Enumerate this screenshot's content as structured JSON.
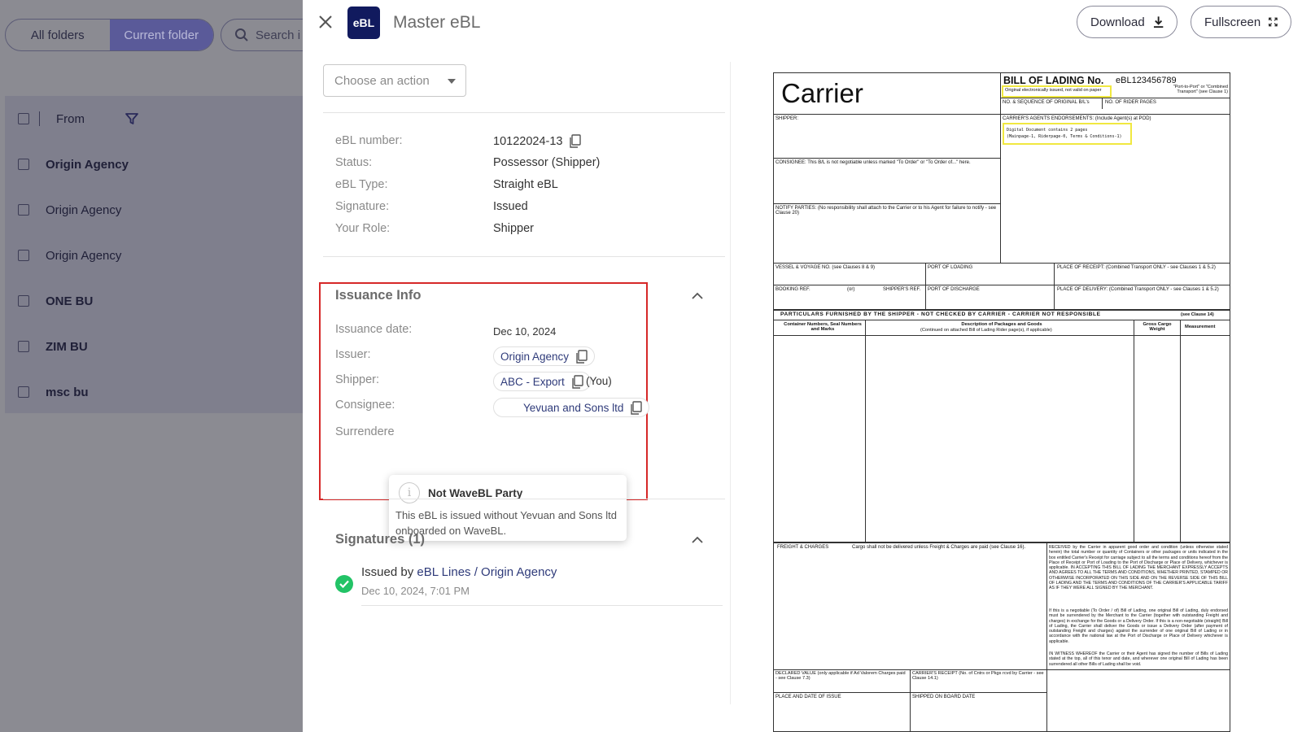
{
  "background": {
    "folders": [
      {
        "label": "All folders"
      },
      {
        "label": "Current folder"
      }
    ],
    "search_placeholder": "Search i",
    "table_header": "From",
    "rows": [
      {
        "label": "Origin Agency",
        "bold": true
      },
      {
        "label": "Origin Agency",
        "bold": false
      },
      {
        "label": "Origin Agency",
        "bold": false
      },
      {
        "label": "ONE BU",
        "bold": true
      },
      {
        "label": "ZIM BU",
        "bold": true
      },
      {
        "label": "msc bu",
        "bold": true
      }
    ]
  },
  "header": {
    "badge": "eBL",
    "title": "Master eBL",
    "download_label": "Download",
    "fullscreen_label": "Fullscreen"
  },
  "action_select": {
    "placeholder": "Choose an action"
  },
  "details": [
    {
      "key": "eBL number:",
      "value": "10122024-13"
    },
    {
      "key": "Status:",
      "value": "Possessor (Shipper)"
    },
    {
      "key": "eBL Type:",
      "value": "Straight eBL"
    },
    {
      "key": "Signature:",
      "value": "Issued"
    },
    {
      "key": "Your Role:",
      "value": "Shipper"
    }
  ],
  "issuance": {
    "title": "Issuance Info",
    "date_label": "Issuance date:",
    "date_value": "Dec 10, 2024",
    "issuer_label": "Issuer:",
    "issuer_value": "Origin Agency",
    "shipper_label": "Shipper:",
    "shipper_value": "ABC - Export",
    "shipper_suffix": "(You)",
    "consignee_label": "Consignee:",
    "consignee_value": "Yevuan and Sons ltd",
    "surrender_label": "Surrendere"
  },
  "tooltip": {
    "title": "Not WaveBL Party",
    "body": "This eBL is issued without Yevuan and Sons ltd onboarded on WaveBL."
  },
  "signatures": {
    "title": "Signatures (1)",
    "items": [
      {
        "prefix": "Issued by ",
        "who": "eBL Lines / Origin Agency",
        "date": "Dec 10, 2024, 7:01 PM"
      }
    ]
  },
  "document": {
    "carrier": "Carrier",
    "title": "BILL OF LADING No.",
    "number": "eBL123456789",
    "original_note": "Original electronically issued, not valid on paper",
    "port_note": "\"Port-to-Port\" or \"Combined Transport\" (see Clause 1)",
    "seq_label": "NO. & SEQUENCE OF ORIGINAL B/L's",
    "rider_label": "NO. OF RIDER PAGES",
    "shipper_label": "SHIPPER:",
    "agents_label": "CARRIER'S AGENTS ENDORSEMENTS: (Include Agent(s) at POD)",
    "digital_note_1": "Digital Document contains 2 pages",
    "digital_note_2": "(Mainpage-1, Riderpage-0, Terms & Conditions-1)",
    "consignee_label": "CONSIGNEE: This B/L is not negotiable unless marked \"To Order\" or \"To Order of...\" here.",
    "notify_label": "NOTIFY PARTIES: (No responsibility shall attach to the Carrier or to his Agent for failure to notify - see Clause 20)",
    "vessel_label": "VESSEL & VOYAGE NO. (see Clauses 8 & 9)",
    "pol_label": "PORT OF LOADING",
    "por_label": "PLACE OF RECEIPT: (Combined Transport ONLY - see Clauses 1 & 5.2)",
    "booking_label": "BOOKING REF.",
    "or_label": "(or)",
    "shippers_ref_label": "SHIPPER'S REF.",
    "pod_label": "PORT OF DISCHARGE",
    "pdel_label": "PLACE OF DELIVERY: (Combined Transport ONLY - see Clauses 1 & 5.2)",
    "particulars": "PARTICULARS FURNISHED BY THE SHIPPER - NOT CHECKED BY CARRIER - CARRIER NOT RESPONSIBLE",
    "particulars_clause": "(see Clause 14)",
    "col_container": "Container Numbers, Seal Numbers and Marks",
    "col_desc": "Description of Packages and Goods",
    "col_desc_sub": "(Continued on attached Bill of Lading Rider page(s), if applicable)",
    "col_weight": "Gross Cargo Weight",
    "col_measure": "Measurement",
    "freight_label": "FREIGHT & CHARGES",
    "cargo_note": "Cargo shall not be delivered unless Freight & Charges are paid (see Clause 16).",
    "received_text": "RECEIVED by the Carrier in apparent good order and condition (unless otherwise stated herein) the total number or quantity of Containers or other packages or units indicated in the box entitled Carrier's Receipt for carriage subject to all the terms and conditions hereof from the Place of Receipt or Port of Loading to the Port of Discharge or Place of Delivery, whichever is applicable. IN ACCEPTING THIS BILL OF LADING THE MERCHANT EXPRESSLY ACCEPTS AND AGREES TO ALL THE TERMS AND CONDITIONS, WHETHER PRINTED, STAMPED OR OTHERWISE INCORPORATED ON THIS SIDE AND ON THE REVERSE SIDE OF THIS BILL OF LADING AND THE TERMS AND CONDITIONS OF THE CARRIER'S APPLICABLE TARIFF AS IF THEY WERE ALL SIGNED BY THE MERCHANT.",
    "negotiable_text": "If this is a negotiable (To Order / of) Bill of Lading, one original Bill of Lading, duly endorsed must be surrendered by the Merchant to the Carrier (together with outstanding Freight and charges) in exchange for the Goods or a Delivery Order. If this is a non-negotiable (straight) Bill of Lading, the Carrier shall deliver the Goods or issue a Delivery Order (after payment of outstanding Freight and charges) against the surrender of one original Bill of Lading or in accordance with the national law at the Port of Discharge or Place of Delivery whichever is applicable.",
    "witness_text": "IN WITNESS WHEREOF the Carrier or their Agent has signed the number of Bills of Lading stated at the top, all of this tenor and date, and wherever one original Bill of Lading has been surrendered all other Bills of Lading shall be void.",
    "declared_label": "DECLARED VALUE (only applicable if Ad Valorem Charges paid - see Clause 7.3)",
    "receipt_label": "CARRIER'S RECEIPT (No. of Cntrs or Pkgs rcvd by Carrier - see Clause 14.1)",
    "place_issue_label": "PLACE AND DATE OF ISSUE",
    "shipped_label": "SHIPPED ON BOARD DATE"
  }
}
